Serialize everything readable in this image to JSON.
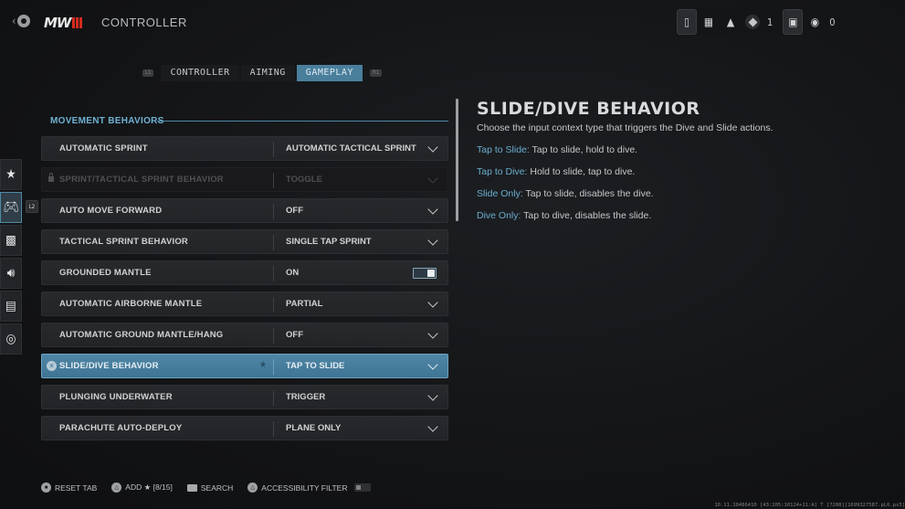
{
  "header": {
    "logo_text": "MW",
    "title": "CONTROLLER",
    "top_right": {
      "icons": [
        "controller-battery-icon",
        "grid-menu-icon",
        "notification-bell-icon",
        "prestige-rank-icon",
        "player-card-icon",
        "friends-icon"
      ],
      "rank_count": "1",
      "friends_count": "0"
    }
  },
  "tabs": {
    "left_bumper": "L1",
    "right_bumper": "R1",
    "items": [
      {
        "label": "CONTROLLER",
        "active": false
      },
      {
        "label": "AIMING",
        "active": false
      },
      {
        "label": "GAMEPLAY",
        "active": true
      }
    ]
  },
  "rail": {
    "items": [
      "favorites",
      "controller",
      "graphics",
      "audio",
      "interface",
      "network"
    ],
    "badge": "L2",
    "active": "controller"
  },
  "section": {
    "title": "MOVEMENT BEHAVIORS"
  },
  "settings": [
    {
      "label": "AUTOMATIC SPRINT",
      "value": "AUTOMATIC TACTICAL SPRINT",
      "type": "dropdown"
    },
    {
      "label": "SPRINT/TACTICAL SPRINT BEHAVIOR",
      "value": "TOGGLE",
      "type": "dropdown",
      "locked": true
    },
    {
      "label": "AUTO MOVE FORWARD",
      "value": "OFF",
      "type": "dropdown"
    },
    {
      "label": "TACTICAL SPRINT BEHAVIOR",
      "value": "SINGLE TAP SPRINT",
      "type": "dropdown"
    },
    {
      "label": "GROUNDED MANTLE",
      "value": "ON",
      "type": "toggle",
      "on": true
    },
    {
      "label": "AUTOMATIC AIRBORNE MANTLE",
      "value": "PARTIAL",
      "type": "dropdown"
    },
    {
      "label": "AUTOMATIC GROUND MANTLE/HANG",
      "value": "OFF",
      "type": "dropdown"
    },
    {
      "label": "SLIDE/DIVE BEHAVIOR",
      "value": "TAP TO SLIDE",
      "type": "dropdown",
      "selected": true,
      "favorited": true
    },
    {
      "label": "PLUNGING UNDERWATER",
      "value": "TRIGGER",
      "type": "dropdown"
    },
    {
      "label": "PARACHUTE AUTO-DEPLOY",
      "value": "PLANE ONLY",
      "type": "dropdown"
    }
  ],
  "description": {
    "title": "SLIDE/DIVE BEHAVIOR",
    "body": "Choose the input context type that triggers the Dive and Slide actions.",
    "options": [
      {
        "key": "Tap to Slide:",
        "text": " Tap to slide, hold to dive."
      },
      {
        "key": "Tap to Dive:",
        "text": " Hold to slide, tap to dive."
      },
      {
        "key": "Slide Only:",
        "text": " Tap to slide, disables the dive."
      },
      {
        "key": "Dive Only:",
        "text": " Tap to dive, disables the slide."
      }
    ]
  },
  "footer": {
    "reset": "RESET TAB",
    "add": "ADD ★ [8/15]",
    "search": "SEARCH",
    "accessibility": "ACCESSIBILITY FILTER",
    "accessibility_on": false
  },
  "build_string": "10.11.10486410 [43:205:10124+11:A] T [7208][1699327587.pL6.ps5]",
  "colors": {
    "accent": "#4a7f9c",
    "section_title": "#6fb2d2",
    "logo_red": "#d42a1f"
  }
}
